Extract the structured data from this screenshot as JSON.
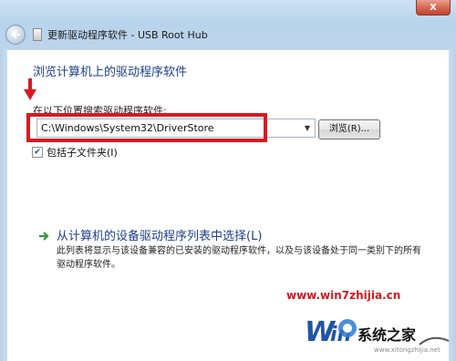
{
  "window": {
    "title": "更新驱动程序软件 - USB Root Hub",
    "close_label": "X"
  },
  "page": {
    "heading": "浏览计算机上的驱动程序软件"
  },
  "search": {
    "label": "在以下位置搜索驱动程序软件:",
    "path_value": "C:\\Windows\\System32\\DriverStore",
    "browse_label": "浏览(R)...",
    "include_subfolders_label": "包括子文件夹(I)",
    "include_subfolders_checked": true
  },
  "pick_option": {
    "title": "从计算机的设备驱动程序列表中选择(L)",
    "description": "此列表将显示与该设备兼容的已安装的驱动程序软件，以及与该设备处于同一类别下的所有驱动程序软件。"
  },
  "watermark": {
    "url": "www.win7zhijia.cn",
    "logo_text": "系统之家",
    "small_url": "www.xitongzhijia.net"
  },
  "colors": {
    "heading_blue": "#1e3f8a",
    "highlight_red": "#d71a21",
    "link_green": "#2f9a3a"
  }
}
